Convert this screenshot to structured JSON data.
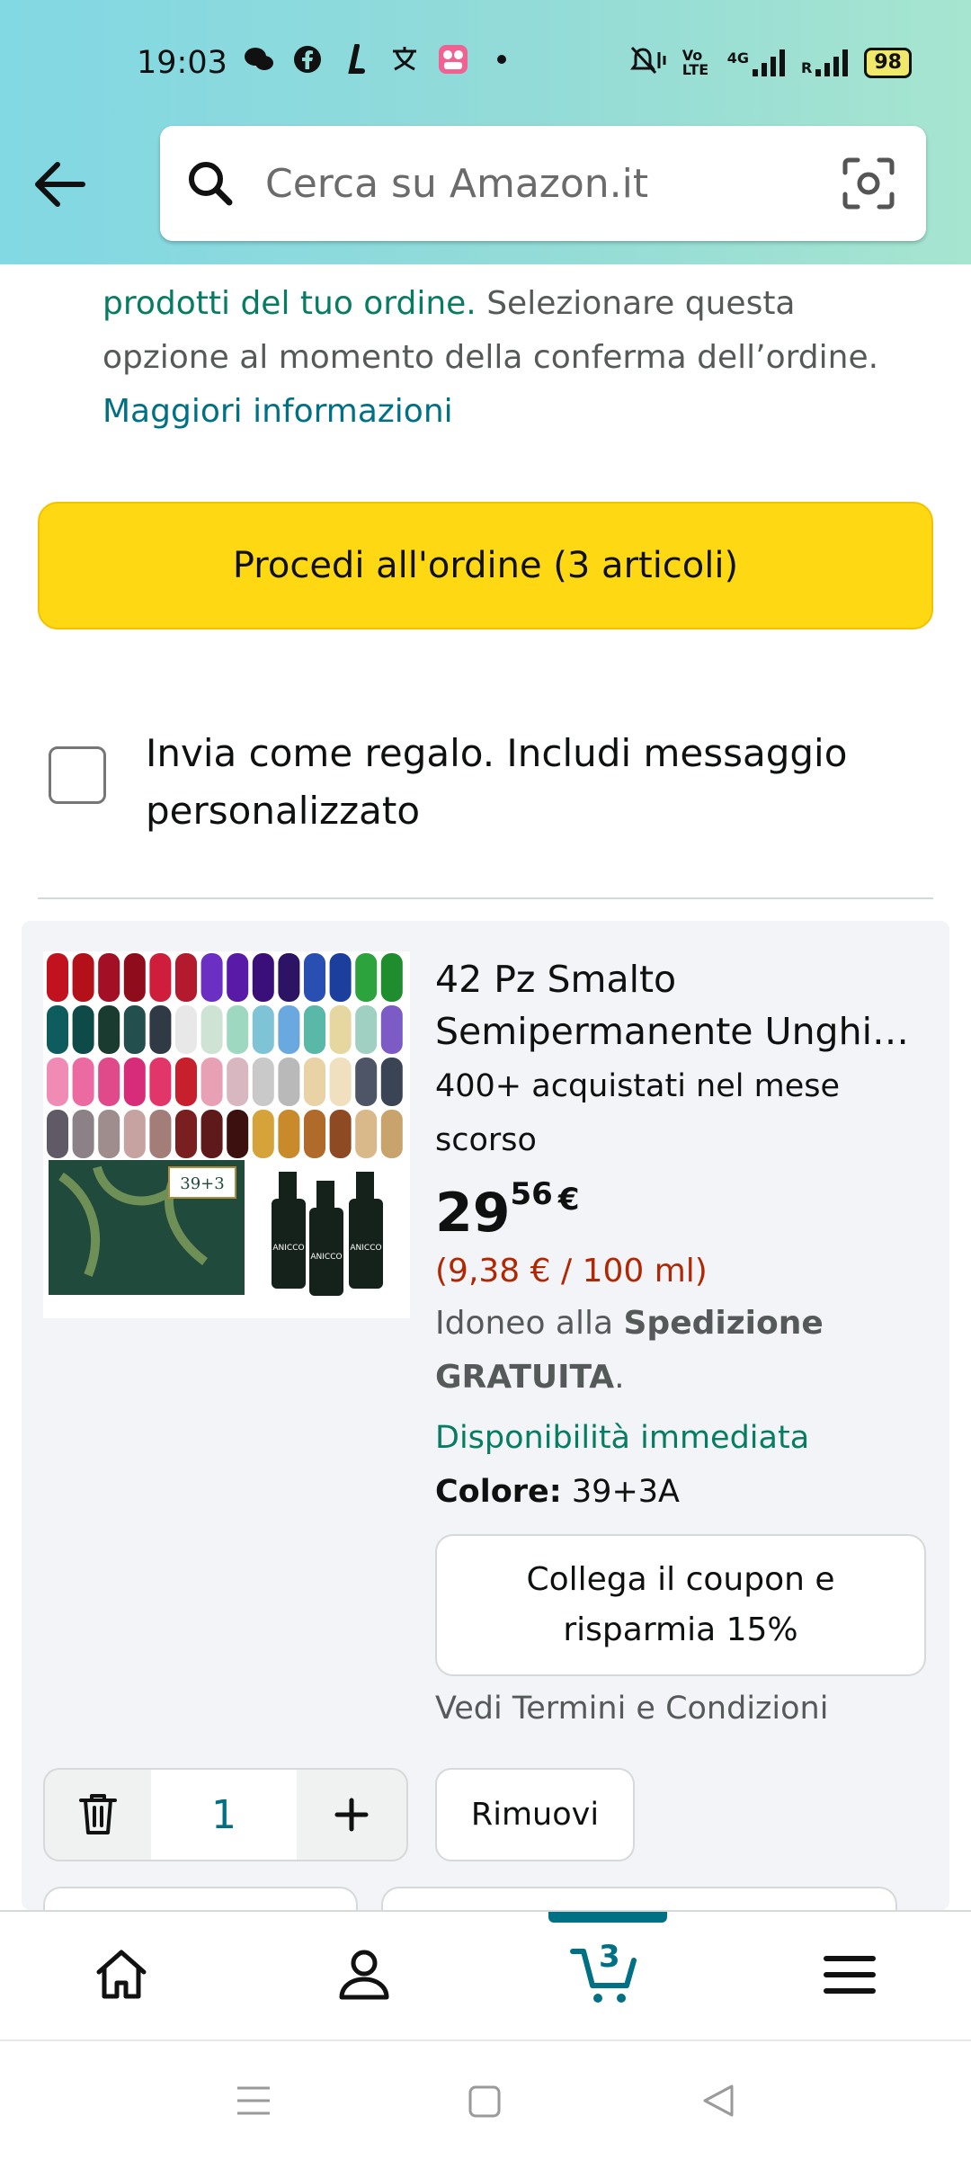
{
  "status_bar": {
    "time": "19:03",
    "battery": "98",
    "network_labels": [
      "Vo LTE",
      "4G",
      "R"
    ]
  },
  "search": {
    "placeholder": "Cerca su Amazon.it"
  },
  "notice": {
    "green_text": "prodotti del tuo ordine.",
    "text": " Selezionare questa opzione al momento della conferma dell’ordine. ",
    "link": "Maggiori informazioni"
  },
  "checkout": {
    "label": "Procedi all'ordine (3 articoli)"
  },
  "gift": {
    "label": "Invia come regalo. Includi messaggio personalizzato"
  },
  "product": {
    "title_line1": "42 Pz Smalto",
    "title_line2": "Semipermanente Unghie con Lampada",
    "bought": "400+ acquistati nel mese scorso",
    "price_int": "29",
    "price_frac": "56",
    "currency": "€",
    "unit_price": "(9,38 € / 100 ml)",
    "ship_prefix": "Idoneo alla ",
    "ship_bold": "Spedizione GRATUITA",
    "ship_suffix": ".",
    "availability": "Disponibilità immediata",
    "color_label": "Colore:",
    "color_value": " 39+3A",
    "coupon_line1": "Collega il coupon e",
    "coupon_line2": "risparmia 15%",
    "terms": "Vedi Termini e Condizioni",
    "quantity": "1",
    "remove_label": "Rimuovi",
    "image_box_label": "39+3",
    "image_brand": "ANICCO"
  },
  "bottom_nav": {
    "cart_count": "3"
  },
  "colors": {
    "accent_teal": "#007185",
    "checkout_yellow": "#ffd814",
    "green": "#067d62",
    "price_red": "#b12704"
  }
}
